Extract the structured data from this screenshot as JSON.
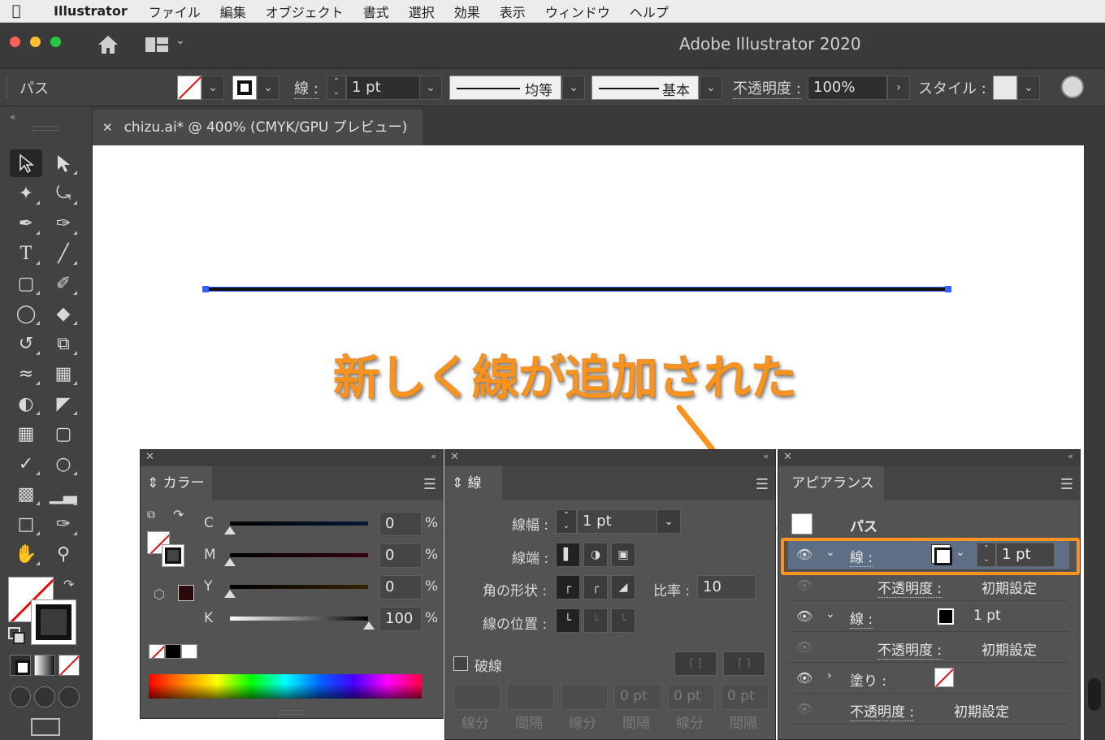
{
  "menubar": {
    "app": "Illustrator",
    "items": [
      "ファイル",
      "編集",
      "オブジェクト",
      "書式",
      "選択",
      "効果",
      "表示",
      "ウィンドウ",
      "ヘルプ"
    ]
  },
  "window": {
    "title": "Adobe Illustrator 2020"
  },
  "controlbar": {
    "selection_type": "パス",
    "stroke_label": "線 :",
    "stroke_weight": "1 pt",
    "variable_width_profile": "均等",
    "brush_definition": "基本",
    "opacity_label": "不透明度 :",
    "opacity_value": "100%",
    "style_label": "スタイル :"
  },
  "document": {
    "tab_title": "chizu.ai* @ 400% (CMYK/GPU プレビュー)"
  },
  "annotation": {
    "text": "新しく線が追加された",
    "color": "#f7931e"
  },
  "color_panel": {
    "title": "カラー",
    "channels": [
      {
        "label": "C",
        "value": "0",
        "unit": "%"
      },
      {
        "label": "M",
        "value": "0",
        "unit": "%"
      },
      {
        "label": "Y",
        "value": "0",
        "unit": "%"
      },
      {
        "label": "K",
        "value": "100",
        "unit": "%"
      }
    ]
  },
  "stroke_panel": {
    "title": "線",
    "weight_label": "線幅 :",
    "weight_value": "1 pt",
    "cap_label": "線端 :",
    "corner_label": "角の形状 :",
    "limit_label": "比率 :",
    "limit_value": "10",
    "align_label": "線の位置 :",
    "dashed_label": "破線",
    "dash_values": [
      "",
      "",
      "",
      "0 pt",
      "0 pt",
      "0 pt"
    ],
    "dash_labels": [
      "線分",
      "間隔",
      "線分",
      "間隔",
      "線分",
      "間隔"
    ]
  },
  "appearance_panel": {
    "title": "アピアランス",
    "object_label": "パス",
    "rows": [
      {
        "name": "線 :",
        "weight": "1 pt"
      },
      {
        "name": "不透明度 :",
        "value": "初期設定"
      },
      {
        "name": "線 :",
        "weight": "1 pt"
      },
      {
        "name": "不透明度 :",
        "value": "初期設定"
      },
      {
        "name": "塗り :"
      },
      {
        "name": "不透明度 :",
        "value": "初期設定"
      }
    ]
  },
  "colors": {
    "accent": "#f7931e",
    "selection": "#3060ff"
  }
}
